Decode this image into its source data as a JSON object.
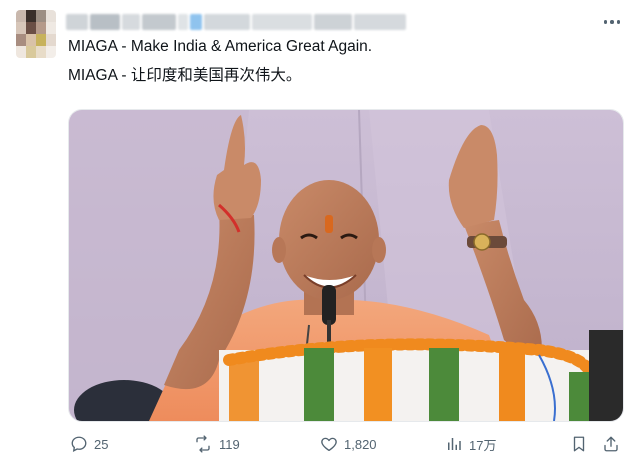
{
  "tweet": {
    "text_line1": "MIAGA - Make India & America Great Again.",
    "text_line2": "MIAGA - 让印度和美国再次伟大。",
    "author_name_blurred": true,
    "media": {
      "alt_subject": "photo"
    }
  },
  "actions": {
    "reply_count": "25",
    "retweet_count": "119",
    "like_count": "1,820",
    "views_count": "17万"
  },
  "icons": {
    "reply": "comment-bubble-icon",
    "retweet": "retweet-icon",
    "like": "heart-icon",
    "views": "bar-chart-icon",
    "bookmark": "bookmark-icon",
    "share": "share-upload-icon",
    "more": "more-dots-icon"
  },
  "colors": {
    "text": "#0f1419",
    "muted": "#536471",
    "background": "#ffffff"
  }
}
